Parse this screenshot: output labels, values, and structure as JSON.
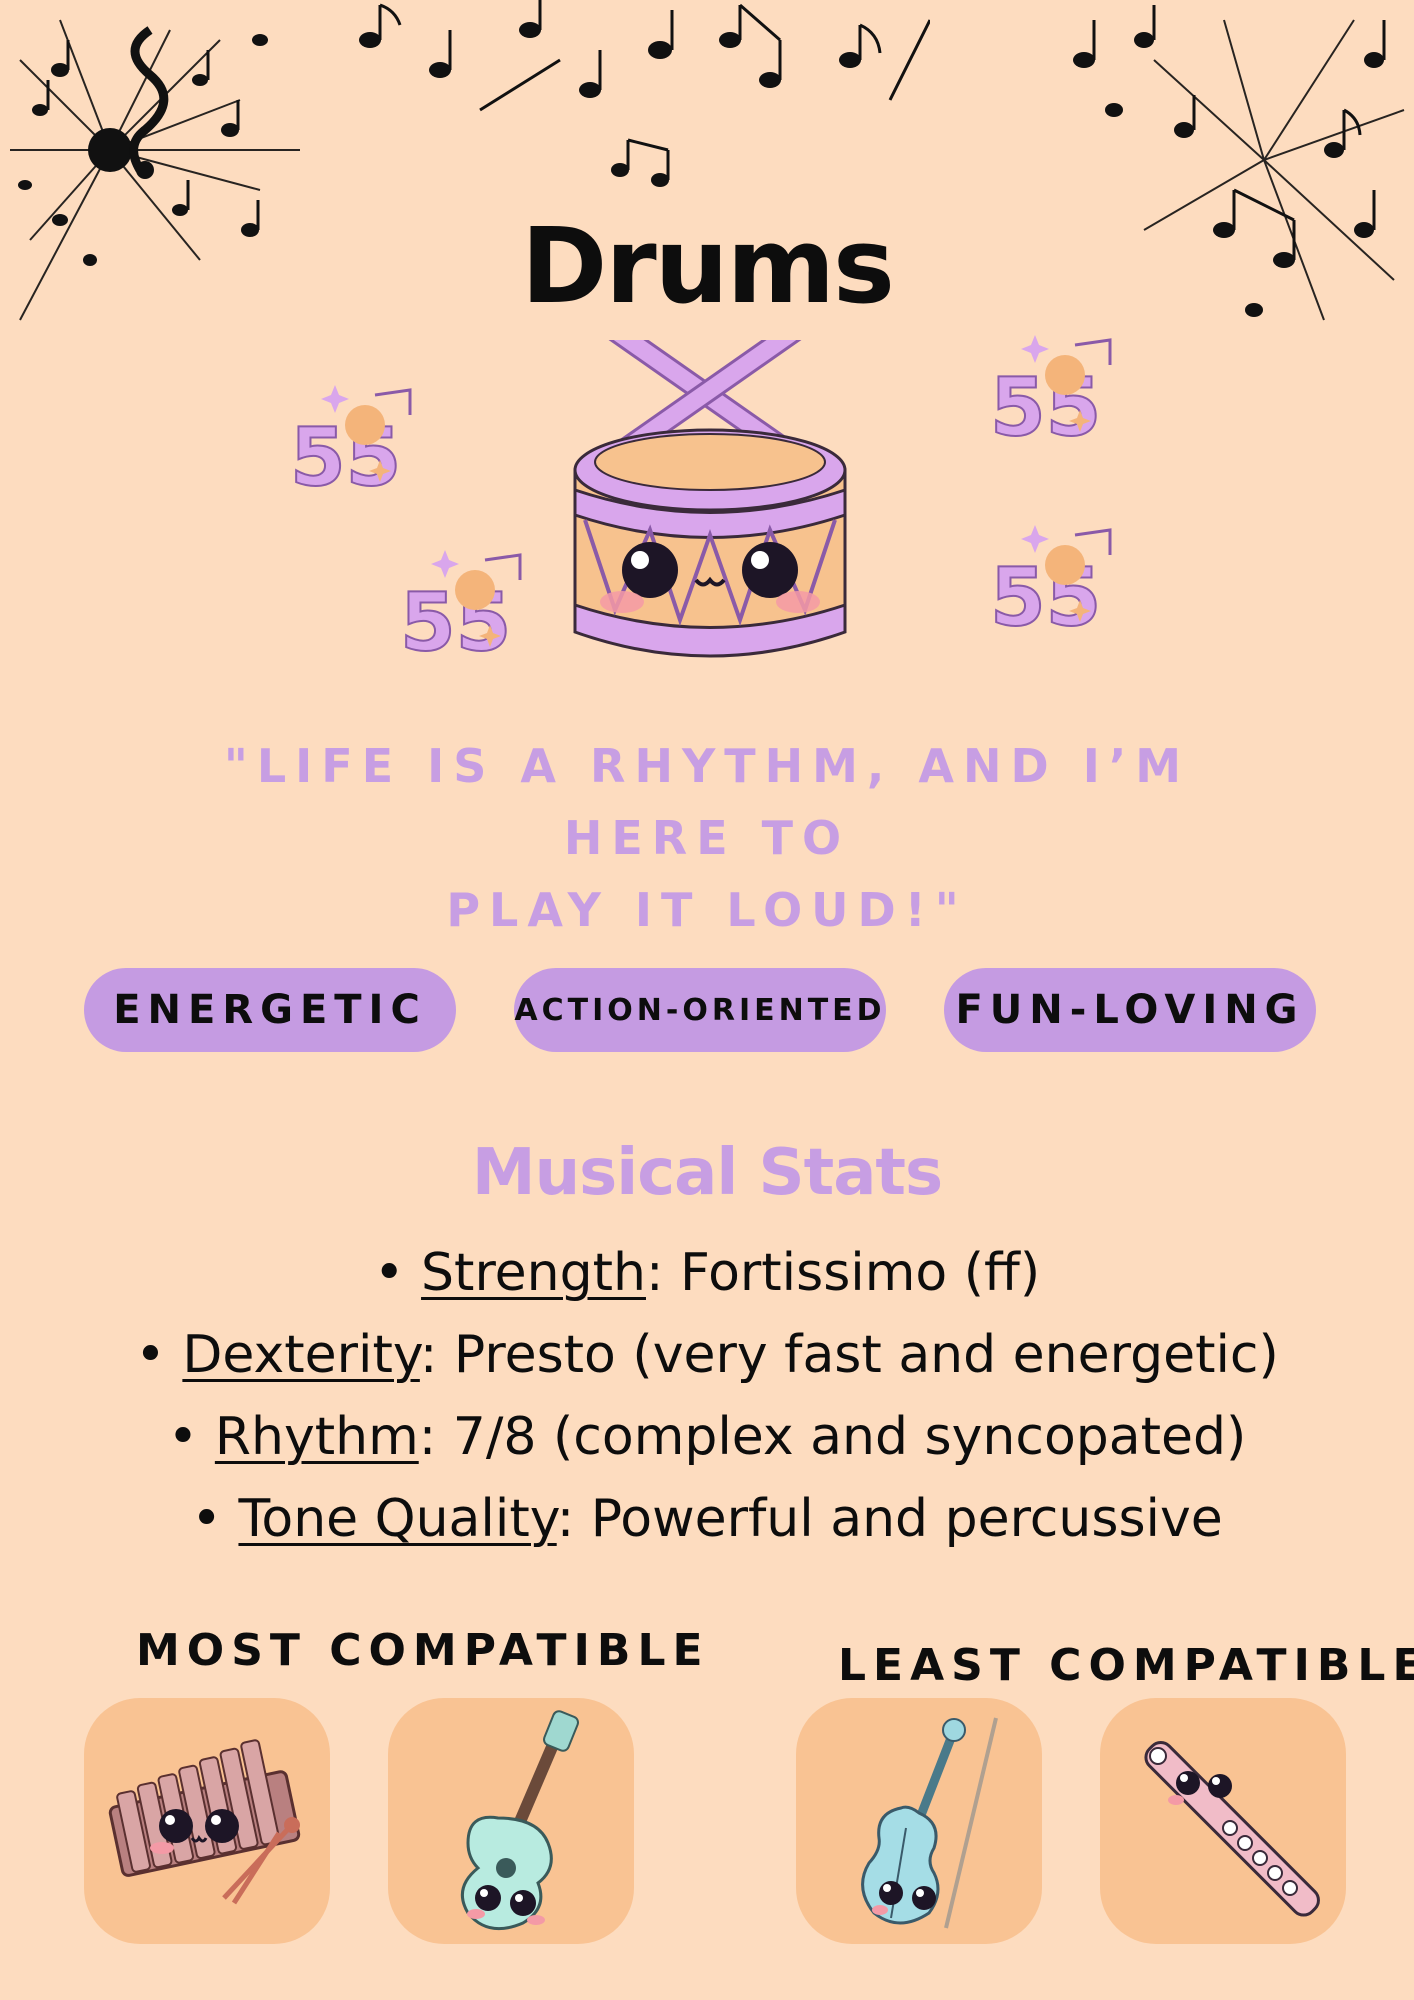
{
  "title": "Drums",
  "quote": {
    "line1": "\"LIFE IS A RHYTHM, AND I’M HERE TO",
    "line2": "PLAY IT LOUD!\""
  },
  "traits": [
    "ENERGETIC",
    "ACTION-ORIENTED",
    "FUN-LOVING"
  ],
  "stats_heading": "Musical Stats",
  "stats": [
    {
      "bullet": "•",
      "key": "Strength",
      "value": ": Fortissimo (ff)"
    },
    {
      "bullet": "•",
      "key": "Dexterity",
      "value": ": Presto (very fast and energetic)"
    },
    {
      "bullet": "•",
      "key": "Rhythm",
      "value": ": 7/8 (complex and syncopated)"
    },
    {
      "bullet": "•",
      "key": "Tone Quality",
      "value": ": Powerful and percussive"
    }
  ],
  "most_compatible": {
    "label": "MOST COMPATIBLE",
    "icons": [
      "xylophone-icon",
      "guitar-icon"
    ]
  },
  "least_compatible": {
    "label": "LEAST COMPATIBLE",
    "icons": [
      "violin-icon",
      "flute-icon"
    ]
  },
  "colors": {
    "background": "#fddcbf",
    "accent_purple": "#c59be2",
    "tile": "#f9c393",
    "text": "#0d0d0d"
  }
}
